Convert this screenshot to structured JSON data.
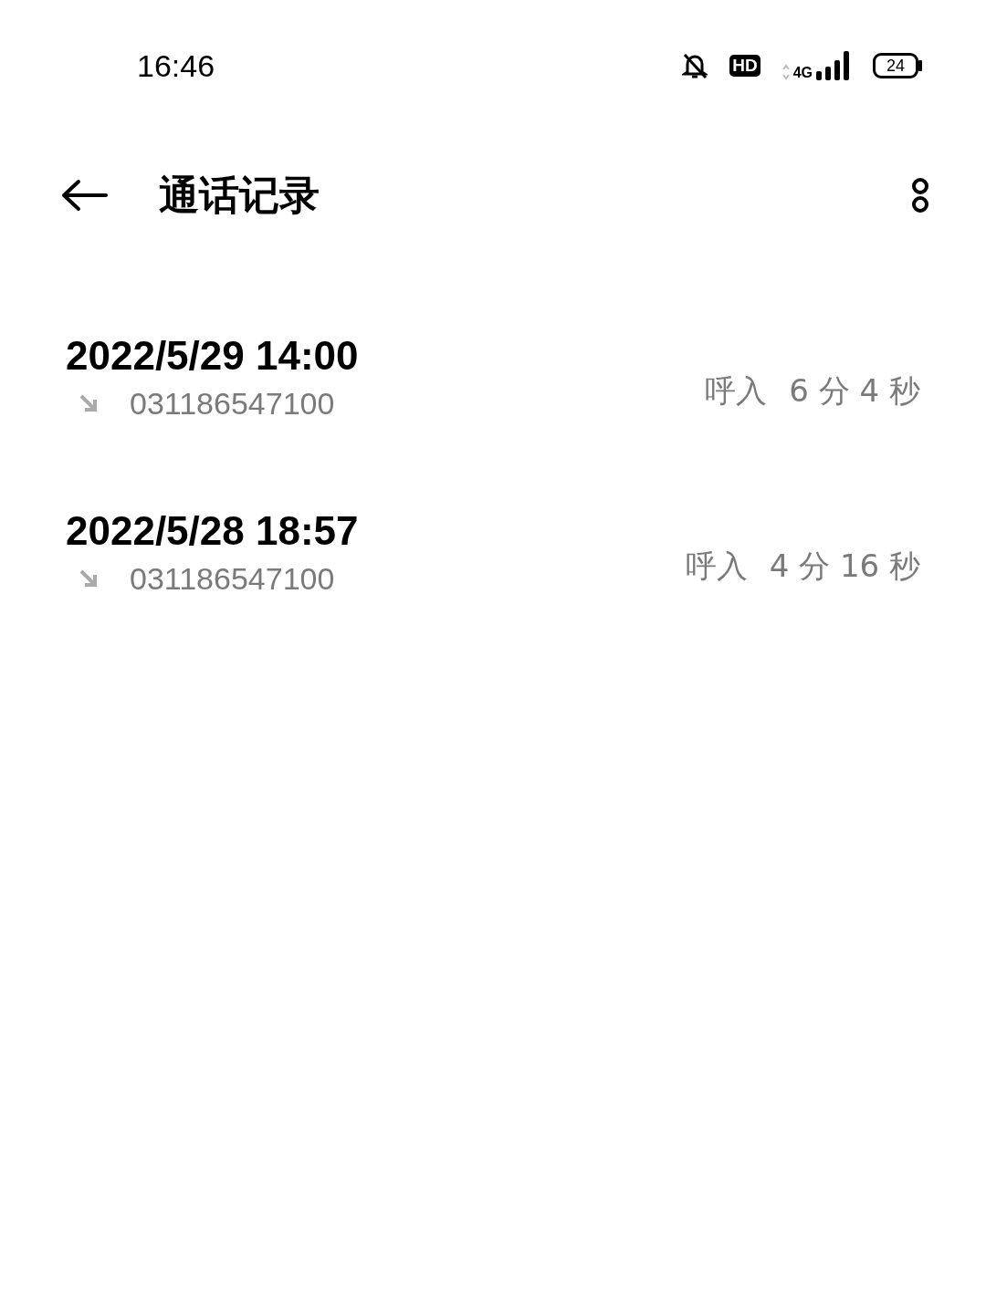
{
  "status_bar": {
    "time": "16:46",
    "hd": "HD",
    "network": "4G",
    "battery": "24"
  },
  "header": {
    "title": "通话记录"
  },
  "calls": [
    {
      "datetime": "2022/5/29 14:00",
      "number": "031186547100",
      "kind": "incoming",
      "type": "呼入",
      "duration": "6 分 4 秒"
    },
    {
      "datetime": "2022/5/28 18:57",
      "number": "031186547100",
      "kind": "incoming",
      "type": "呼入",
      "duration": "4 分 16 秒"
    }
  ]
}
